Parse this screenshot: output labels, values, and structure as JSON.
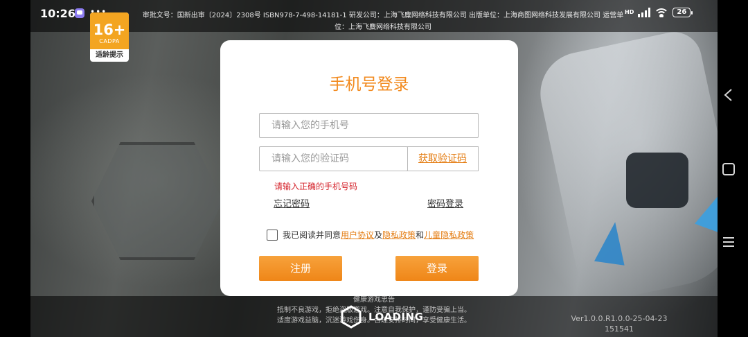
{
  "status_bar": {
    "time": "10:26",
    "more": "•••",
    "network_label": "HD",
    "battery": "26"
  },
  "license_text": "审批文号：国新出审〔2024〕2308号 ISBN978-7-498-14181-1 研发公司：上海飞麋网络科技有限公司 出版单位：上海商图网络科技发展有限公司 运营单位：上海飞麋网络科技有限公司",
  "age_badge": {
    "rating": "16+",
    "org": "CADPA",
    "label": "适龄提示"
  },
  "login": {
    "title": "手机号登录",
    "phone_placeholder": "请输入您的手机号",
    "code_placeholder": "请输入您的验证码",
    "get_code": "获取验证码",
    "error": "请输入正确的手机号码",
    "forgot_password": "忘记密码",
    "password_login": "密码登录",
    "agree_prefix": "我已阅读并同意",
    "user_agreement": "用户协议",
    "and1": "及",
    "privacy_policy": "隐私政策",
    "and2": "和",
    "child_privacy": "儿童隐私政策",
    "register": "注册",
    "login_button": "登录"
  },
  "health_notice": {
    "title": "健康游戏忠告",
    "line1": "抵制不良游戏，拒绝盗版游戏。注意自我保护，谨防受骗上当。",
    "line2": "适度游戏益脑，沉迷游戏伤身。合理安排时间，享受健康生活。"
  },
  "loading_text": "LOADING",
  "version": {
    "line1": "Ver1.0.0.R1.0.0-25-04-23",
    "line2": "151541"
  },
  "colors": {
    "accent": "#f28a1e",
    "error": "#d4222a",
    "link": "#e47d13"
  },
  "icons": {
    "back": "back-chevron-icon",
    "home": "home-square-icon",
    "menu": "menu-lines-icon"
  }
}
